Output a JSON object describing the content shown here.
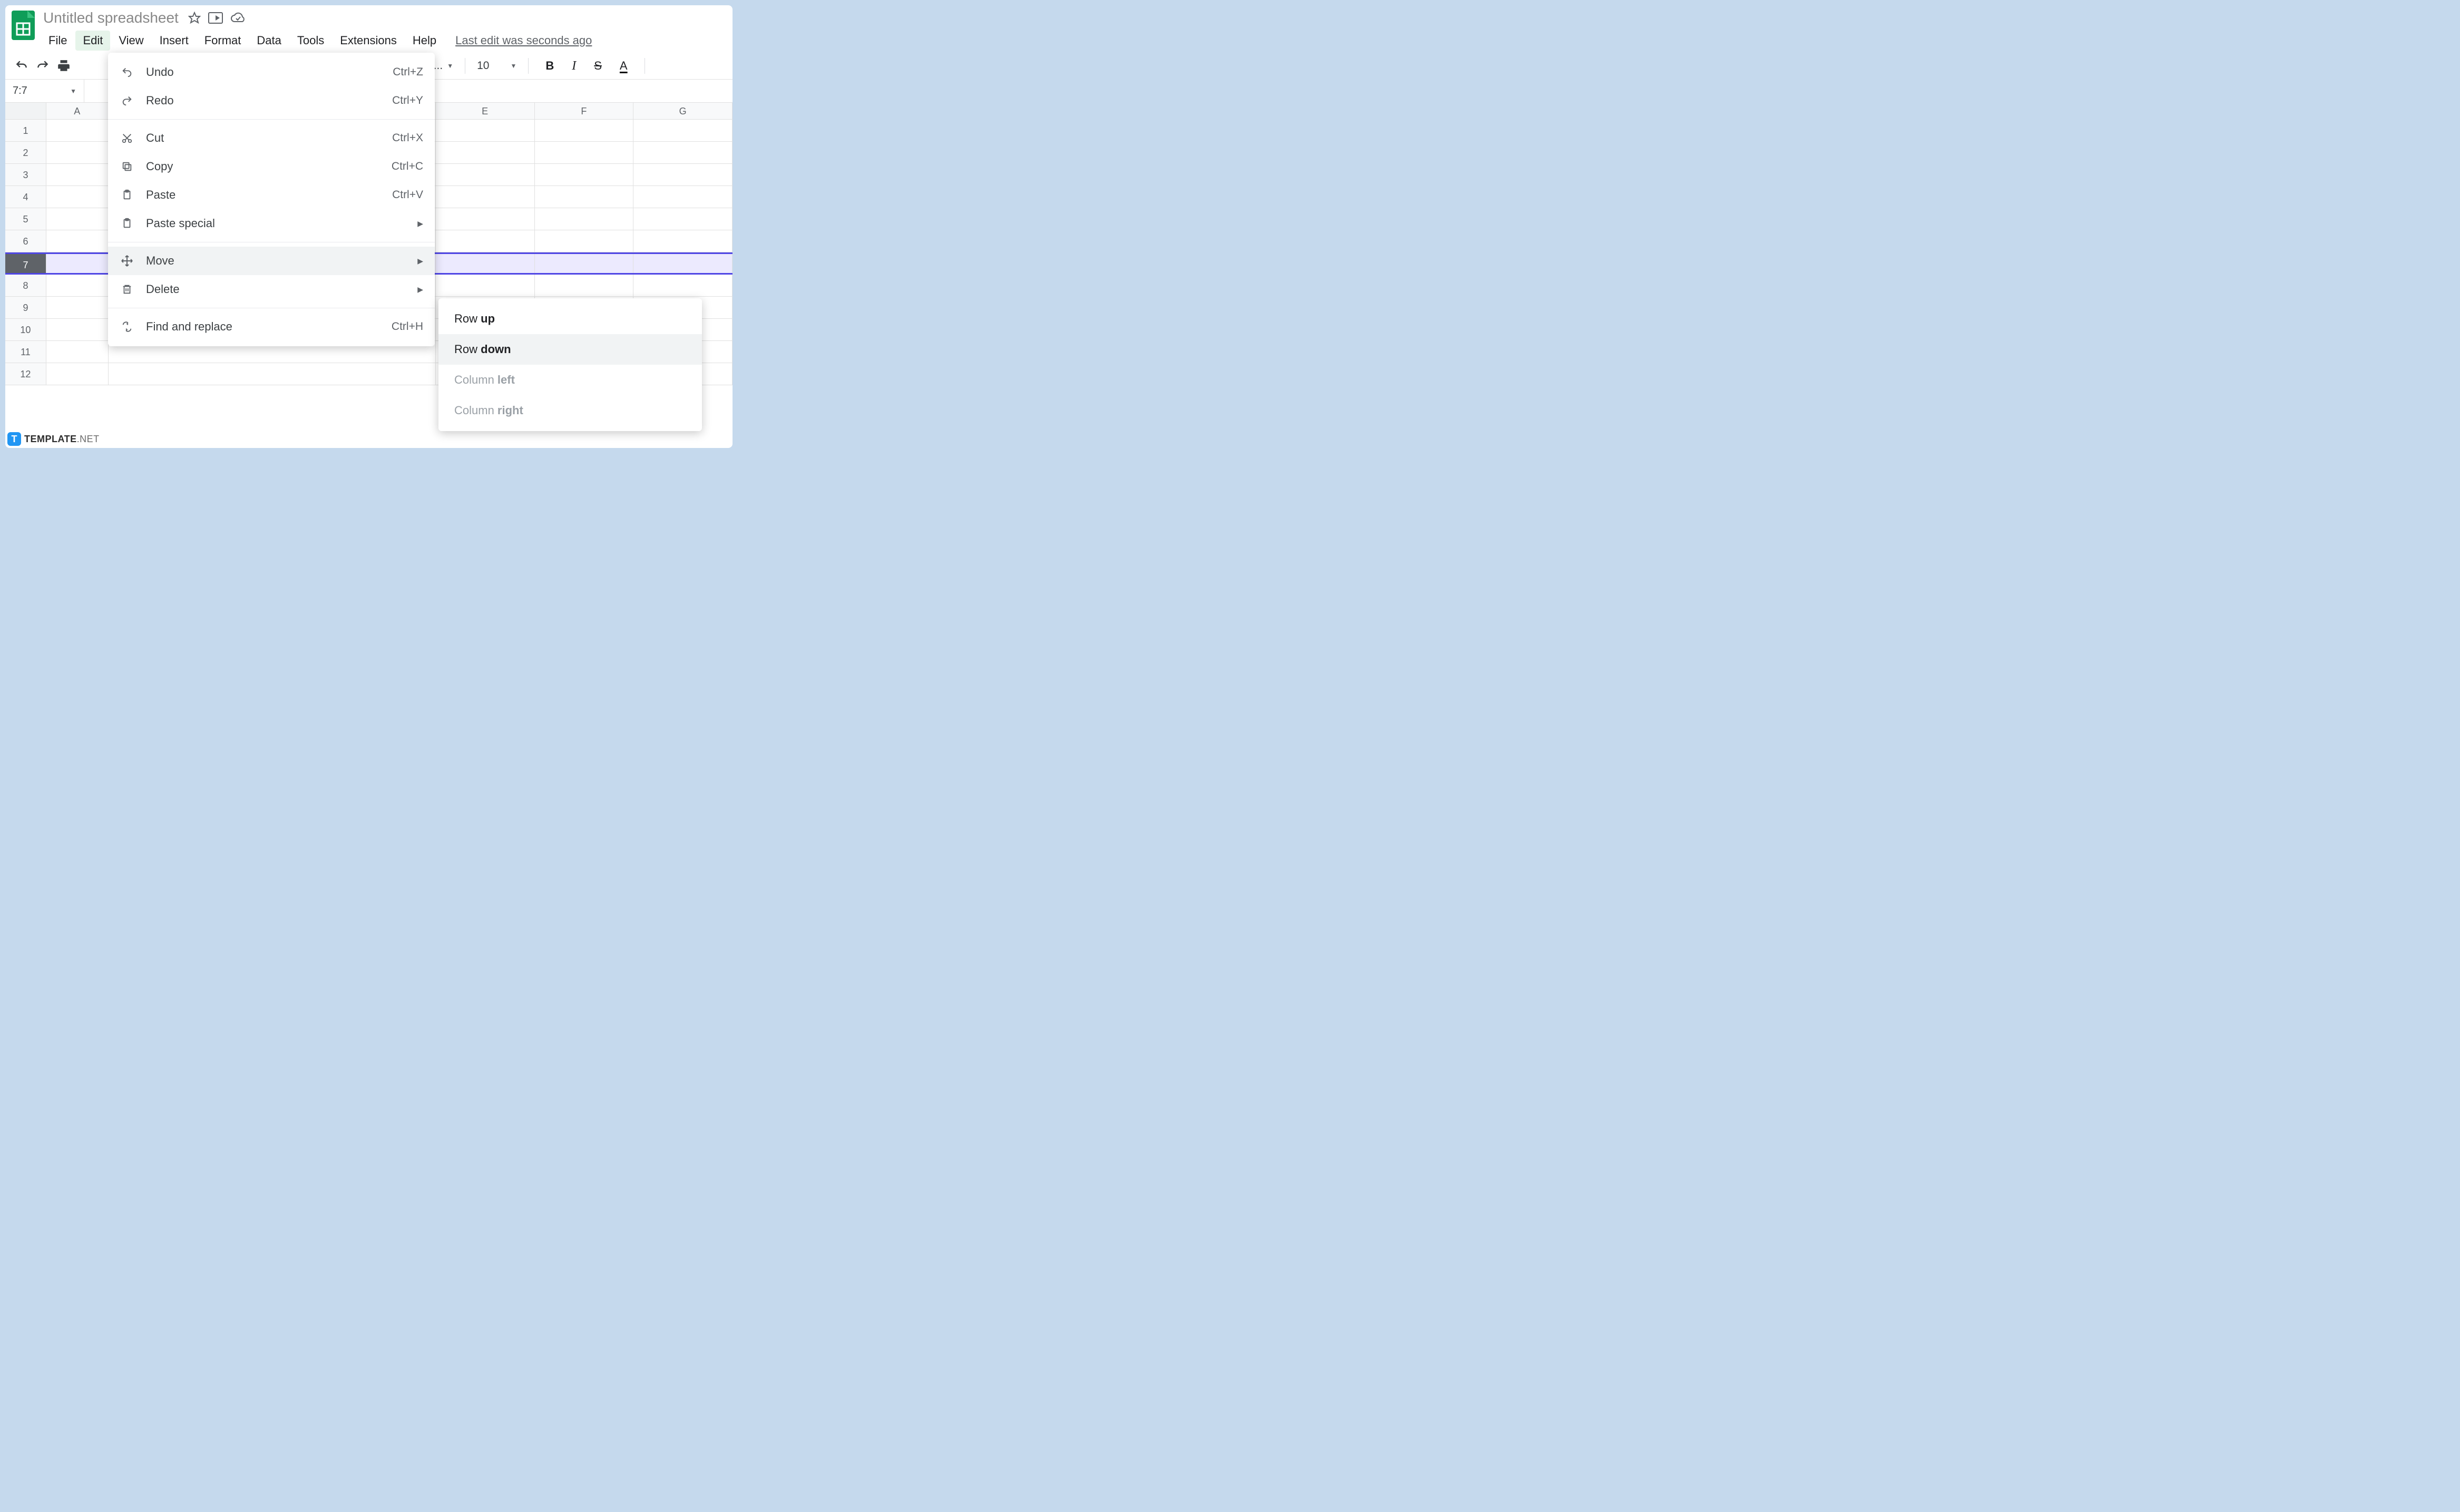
{
  "document": {
    "title": "Untitled spreadsheet",
    "last_edit": "Last edit was seconds ago"
  },
  "menubar": {
    "file": "File",
    "edit": "Edit",
    "view": "View",
    "insert": "Insert",
    "format": "Format",
    "data": "Data",
    "tools": "Tools",
    "extensions": "Extensions",
    "help": "Help"
  },
  "toolbar": {
    "font": "ult (Ari...",
    "font_size": "10",
    "bold": "B",
    "italic": "I",
    "strike": "S",
    "textcolor": "A"
  },
  "namebox": "7:7",
  "columns": [
    "A",
    "E",
    "F",
    "G"
  ],
  "column_widths": {
    "A": 118,
    "gap": 622,
    "E": 188,
    "F": 188,
    "G": 188
  },
  "rows": [
    "1",
    "2",
    "3",
    "4",
    "5",
    "6",
    "7",
    "8",
    "9",
    "10",
    "11",
    "12"
  ],
  "selected_row": "7",
  "edit_menu": {
    "undo": {
      "label": "Undo",
      "shortcut": "Ctrl+Z"
    },
    "redo": {
      "label": "Redo",
      "shortcut": "Ctrl+Y"
    },
    "cut": {
      "label": "Cut",
      "shortcut": "Ctrl+X"
    },
    "copy": {
      "label": "Copy",
      "shortcut": "Ctrl+C"
    },
    "paste": {
      "label": "Paste",
      "shortcut": "Ctrl+V"
    },
    "paste_special": {
      "label": "Paste special"
    },
    "move": {
      "label": "Move"
    },
    "delete": {
      "label": "Delete"
    },
    "find_replace": {
      "label": "Find and replace",
      "shortcut": "Ctrl+H"
    }
  },
  "move_submenu": {
    "row_up": {
      "prefix": "Row ",
      "bold": "up"
    },
    "row_down": {
      "prefix": "Row ",
      "bold": "down"
    },
    "col_left": {
      "prefix": "Column ",
      "bold": "left"
    },
    "col_right": {
      "prefix": "Column ",
      "bold": "right"
    }
  },
  "watermark": {
    "badge": "T",
    "text": "TEMPLATE",
    "net": ".NET"
  }
}
